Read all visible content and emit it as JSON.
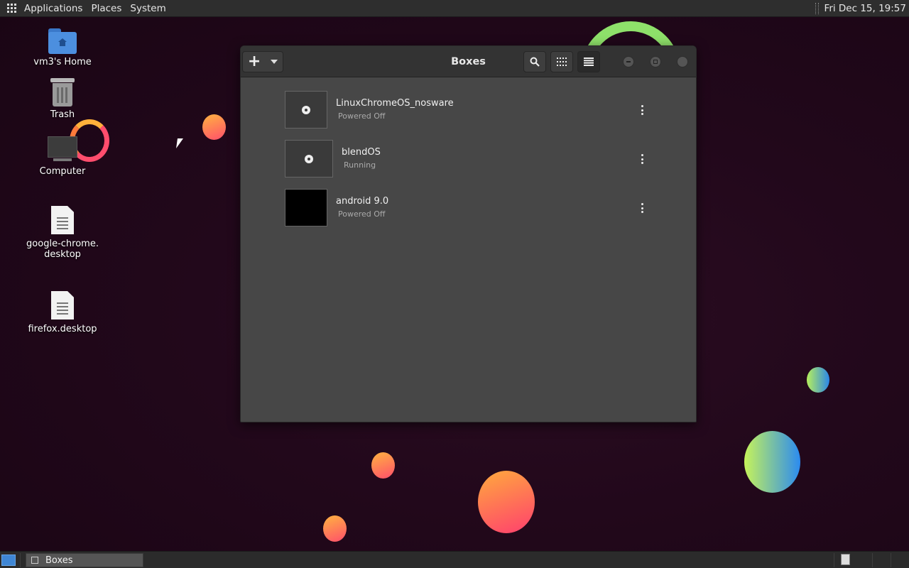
{
  "top_panel": {
    "menus": [
      "Applications",
      "Places",
      "System"
    ],
    "clock": "Fri Dec 15, 19:57"
  },
  "desktop": {
    "icons": [
      {
        "label": "vm3's Home",
        "icon": "folder-home-icon"
      },
      {
        "label": "Trash",
        "icon": "trash-icon"
      },
      {
        "label": "Computer",
        "icon": "computer-icon"
      },
      {
        "label_line1": "google-chrome.",
        "label_line2": "desktop",
        "icon": "text-file-icon"
      },
      {
        "label": "firefox.desktop",
        "icon": "text-file-icon"
      }
    ]
  },
  "window": {
    "title": "Boxes",
    "new_button": "+",
    "vms": [
      {
        "name": "LinuxChromeOS_nosware",
        "state": "Powered Off",
        "thumb": "disc-icon"
      },
      {
        "name": "blendOS",
        "state": "Running",
        "thumb": "disc-icon"
      },
      {
        "name": "android 9.0",
        "state": "Powered Off",
        "thumb": "black-screen"
      }
    ]
  },
  "taskbar": {
    "tasks": [
      {
        "label": "Boxes"
      }
    ]
  },
  "colors": {
    "background": "#22081b",
    "panel": "#2e2e2e",
    "window": "#474747",
    "accent": "#3f86d4"
  }
}
